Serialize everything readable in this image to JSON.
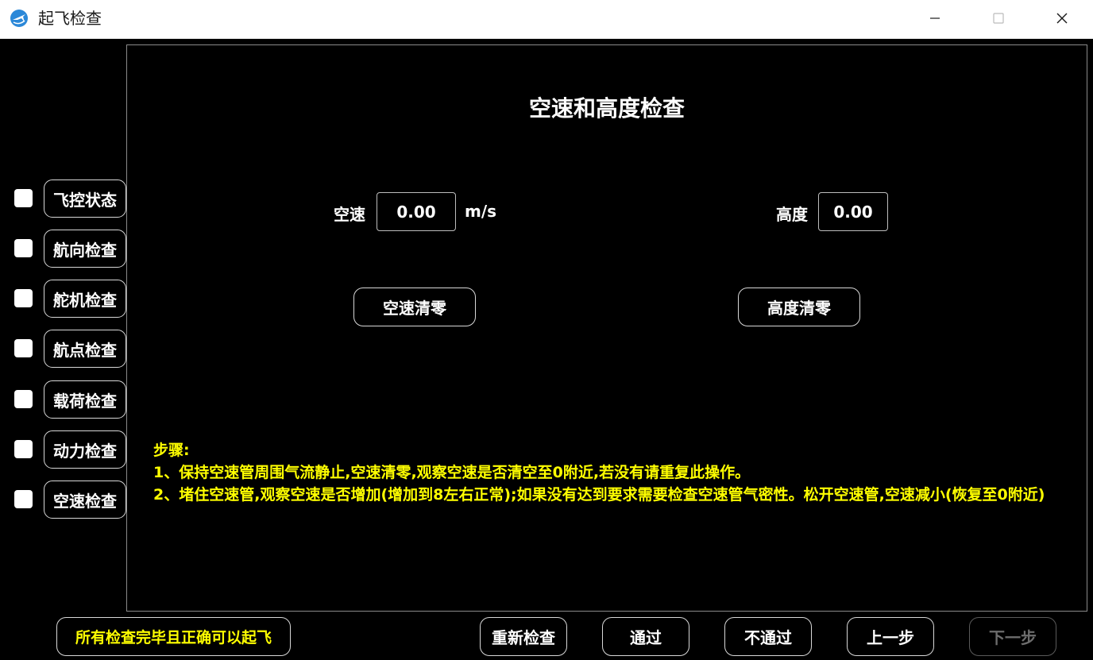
{
  "window": {
    "title": "起飞检查",
    "icon": "airplane-app-icon"
  },
  "sidebar": {
    "items": [
      {
        "label": "飞控状态",
        "checked": false
      },
      {
        "label": "航向检查",
        "checked": false
      },
      {
        "label": "舵机检查",
        "checked": false
      },
      {
        "label": "航点检查",
        "checked": false
      },
      {
        "label": "载荷检查",
        "checked": false
      },
      {
        "label": "动力检查",
        "checked": false
      },
      {
        "label": "空速检查",
        "checked": false
      }
    ]
  },
  "main": {
    "title": "空速和高度检查",
    "airspeed": {
      "label": "空速",
      "value": "0.00",
      "unit": "m/s",
      "reset_label": "空速清零"
    },
    "altitude": {
      "label": "高度",
      "value": "0.00",
      "reset_label": "高度清零"
    },
    "steps": {
      "heading": "步骤:",
      "line1": "1、保持空速管周围气流静止,空速清零,观察空速是否清空至0附近,若没有请重复此操作。",
      "line2": "2、堵住空速管,观察空速是否增加(增加到8左右正常);如果没有达到要求需要检查空速管气密性。松开空速管,空速减小(恢复至0附近)"
    }
  },
  "footer": {
    "status_message": "所有检查完毕且正确可以起飞",
    "recheck_label": "重新检查",
    "pass_label": "通过",
    "fail_label": "不通过",
    "prev_label": "上一步",
    "next_label": "下一步"
  },
  "colors": {
    "background": "#000000",
    "text": "#ffffff",
    "highlight": "#ffff00",
    "border": "#d8d8d8",
    "disabled": "#6d6d6d"
  }
}
